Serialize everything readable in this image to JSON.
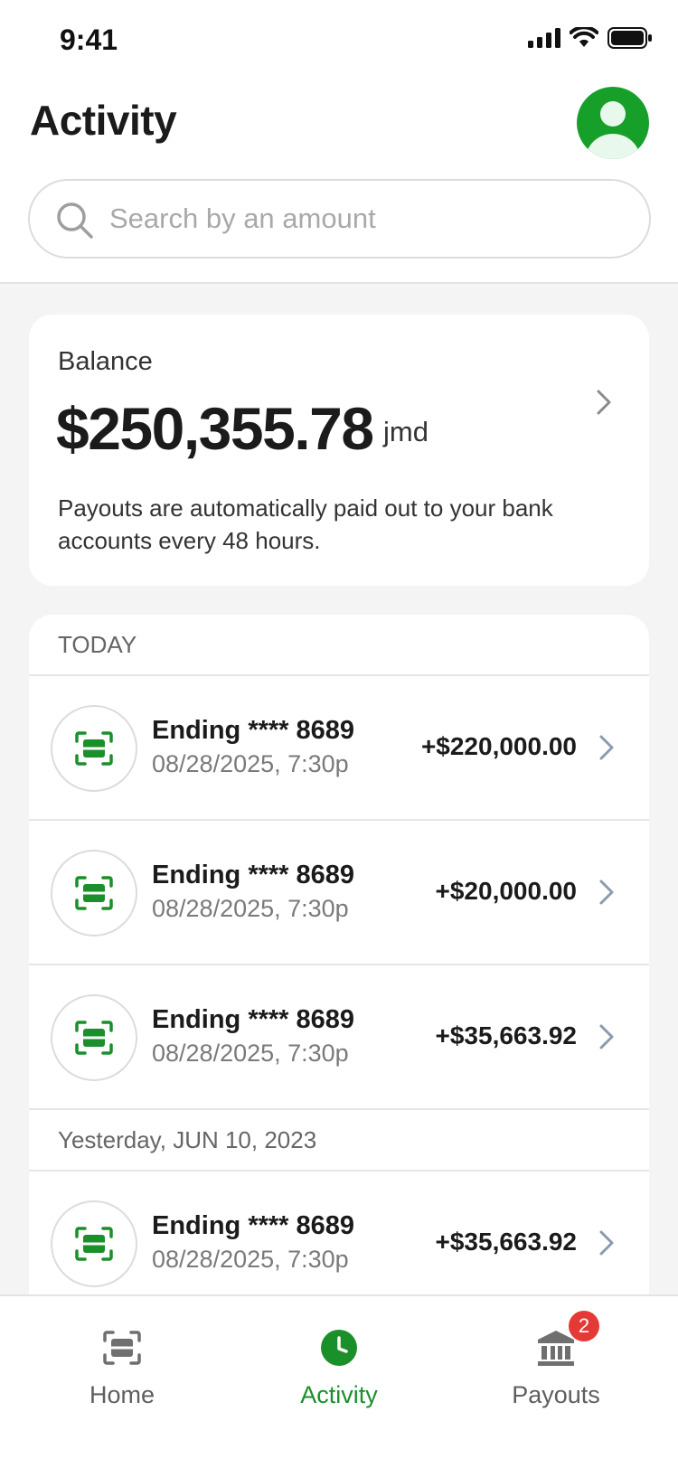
{
  "status": {
    "time": "9:41"
  },
  "header": {
    "title": "Activity"
  },
  "search": {
    "placeholder": "Search by an amount",
    "value": ""
  },
  "balance": {
    "label": "Balance",
    "amount": "$250,355.78",
    "currency": "jmd",
    "note": "Payouts are automatically paid out to your bank accounts every 48 hours."
  },
  "sections": [
    {
      "label": "TODAY",
      "rows": [
        {
          "title": "Ending **** 8689",
          "date": "08/28/2025, 7:30p",
          "amount": "+$220,000.00"
        },
        {
          "title": "Ending **** 8689",
          "date": "08/28/2025, 7:30p",
          "amount": "+$20,000.00"
        },
        {
          "title": "Ending **** 8689",
          "date": "08/28/2025, 7:30p",
          "amount": "+$35,663.92"
        }
      ]
    },
    {
      "label": "Yesterday, JUN 10, 2023",
      "rows": [
        {
          "title": "Ending **** 8689",
          "date": "08/28/2025, 7:30p",
          "amount": "+$35,663.92"
        }
      ]
    }
  ],
  "tabs": [
    {
      "label": "Home",
      "icon": "scan-icon"
    },
    {
      "label": "Activity",
      "icon": "clock-icon",
      "active": true
    },
    {
      "label": "Payouts",
      "icon": "bank-icon",
      "badge": "2"
    }
  ],
  "colors": {
    "accent": "#1a8f2a",
    "badge": "#e53935"
  }
}
